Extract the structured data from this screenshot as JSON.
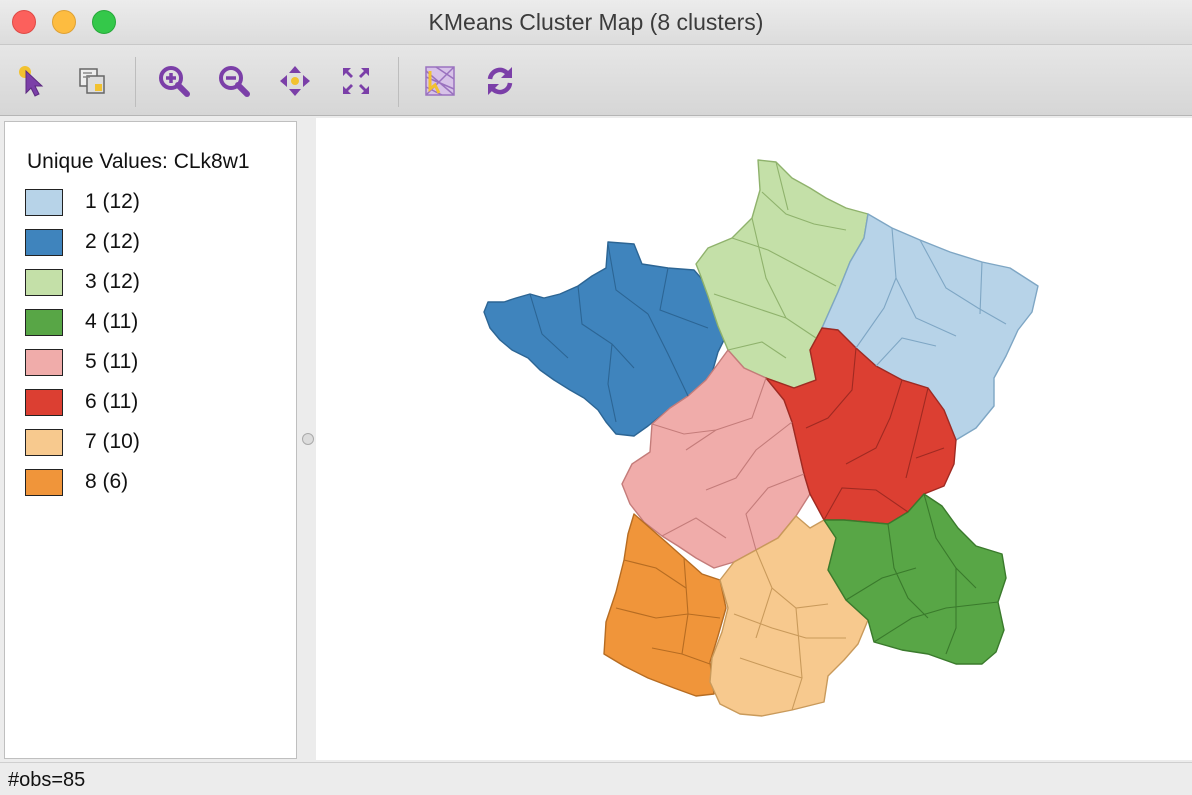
{
  "window": {
    "title": "KMeans Cluster Map (8 clusters)"
  },
  "toolbar": {
    "buttons": [
      {
        "name": "select-tool",
        "icon": "pointer-arrow-icon"
      },
      {
        "name": "selection-shape-tool",
        "icon": "select-shape-icon"
      },
      {
        "name": "zoom-in-tool",
        "icon": "zoom-in-icon"
      },
      {
        "name": "zoom-out-tool",
        "icon": "zoom-out-icon"
      },
      {
        "name": "pan-tool",
        "icon": "pan-arrows-icon"
      },
      {
        "name": "full-extent-tool",
        "icon": "fit-extent-icon"
      },
      {
        "name": "base-map-tool",
        "icon": "basemap-icon"
      },
      {
        "name": "refresh-tool",
        "icon": "refresh-icon"
      }
    ],
    "icon_color": "#7b3fa8"
  },
  "legend": {
    "title": "Unique Values: CLk8w1",
    "items": [
      {
        "label": "1 (12)",
        "color": "#b7d3e8"
      },
      {
        "label": "2 (12)",
        "color": "#3f84bd"
      },
      {
        "label": "3 (12)",
        "color": "#c4e0a8"
      },
      {
        "label": "4 (11)",
        "color": "#58a646"
      },
      {
        "label": "5 (11)",
        "color": "#f0acaa"
      },
      {
        "label": "6 (11)",
        "color": "#dc3f32"
      },
      {
        "label": "7 (10)",
        "color": "#f7c98e"
      },
      {
        "label": "8 (6)",
        "color": "#f0953a"
      }
    ]
  },
  "status": {
    "text": "#obs=85"
  }
}
